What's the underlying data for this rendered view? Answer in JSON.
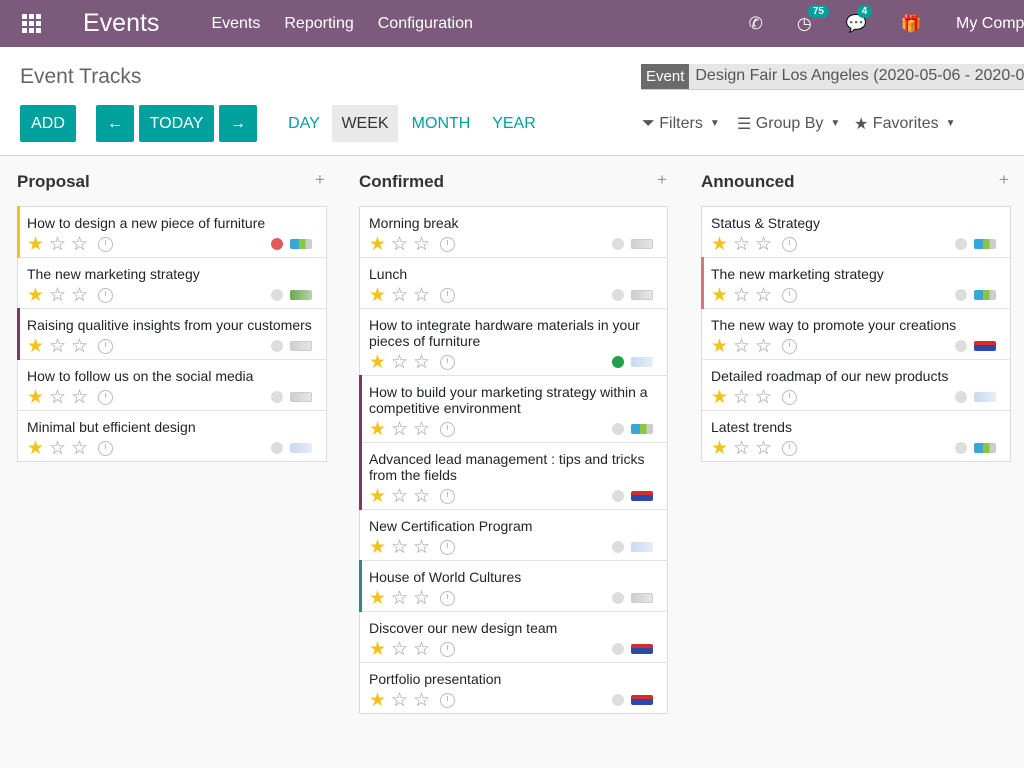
{
  "navbar": {
    "brand": "Events",
    "menu": [
      "Events",
      "Reporting",
      "Configuration"
    ],
    "activity_count": "75",
    "messages_count": "4",
    "company": "My Comp",
    "icons": [
      "apps-icon",
      "phone-icon",
      "activity-clock-icon",
      "chat-icon",
      "gift-icon"
    ]
  },
  "control_panel": {
    "breadcrumb": "Event Tracks",
    "facet": {
      "label": "Event",
      "value": "Design Fair Los Angeles (2020-05-06 - 2020-0"
    },
    "buttons": {
      "add": "ADD",
      "prev": "←",
      "today": "TODAY",
      "next": "→"
    },
    "scales": [
      "DAY",
      "WEEK",
      "MONTH",
      "YEAR"
    ],
    "active_scale": "WEEK",
    "search_options": {
      "filters": "Filters",
      "group_by": "Group By",
      "favorites": "Favorites"
    }
  },
  "columns": [
    {
      "title": "Proposal",
      "cards": [
        {
          "title": "How to design a new piece of furniture",
          "stars": 1,
          "state": "red",
          "border": "yellow",
          "logo": "l0"
        },
        {
          "title": "The new marketing strategy",
          "stars": 1,
          "state": "grey",
          "border": "",
          "logo": "l4"
        },
        {
          "title": "Raising qualitive insights from your customers",
          "stars": 1,
          "state": "grey",
          "border": "plum",
          "logo": "l1"
        },
        {
          "title": "How to follow us on the social media",
          "stars": 1,
          "state": "grey",
          "border": "",
          "logo": "l1"
        },
        {
          "title": "Minimal but efficient design",
          "stars": 1,
          "state": "grey",
          "border": "",
          "logo": "l2"
        }
      ]
    },
    {
      "title": "Confirmed",
      "cards": [
        {
          "title": "Morning break",
          "stars": 1,
          "state": "grey",
          "border": "",
          "logo": "l1"
        },
        {
          "title": "Lunch",
          "stars": 1,
          "state": "grey",
          "border": "",
          "logo": "l1"
        },
        {
          "title": "How to integrate hardware materials in your pieces of furniture",
          "stars": 1,
          "state": "green",
          "border": "",
          "logo": "l2"
        },
        {
          "title": "How to build your marketing strategy within a competitive environment",
          "stars": 1,
          "state": "grey",
          "border": "plum",
          "logo": "l0"
        },
        {
          "title": "Advanced lead management : tips and tricks from the fields",
          "stars": 1,
          "state": "grey",
          "border": "plum",
          "logo": "l3"
        },
        {
          "title": "New Certification Program",
          "stars": 1,
          "state": "grey",
          "border": "",
          "logo": "l2"
        },
        {
          "title": "House of World Cultures",
          "stars": 1,
          "state": "grey",
          "border": "teal",
          "logo": "l1"
        },
        {
          "title": "Discover our new design team",
          "stars": 1,
          "state": "grey",
          "border": "",
          "logo": "l3"
        },
        {
          "title": "Portfolio presentation",
          "stars": 1,
          "state": "grey",
          "border": "",
          "logo": "l3"
        }
      ]
    },
    {
      "title": "Announced",
      "cards": [
        {
          "title": "Status & Strategy",
          "stars": 1,
          "state": "grey",
          "border": "",
          "logo": "l0"
        },
        {
          "title": "The new marketing strategy",
          "stars": 1,
          "state": "grey",
          "border": "red",
          "logo": "l0"
        },
        {
          "title": "The new way to promote your creations",
          "stars": 1,
          "state": "grey",
          "border": "",
          "logo": "l3"
        },
        {
          "title": "Detailed roadmap of our new products",
          "stars": 1,
          "state": "grey",
          "border": "",
          "logo": "l2"
        },
        {
          "title": "Latest trends",
          "stars": 1,
          "state": "grey",
          "border": "",
          "logo": "l0"
        }
      ]
    }
  ],
  "colors": {
    "navbar": "#7b5a7b",
    "primary": "#00a09d",
    "star": "#f3c31d"
  }
}
